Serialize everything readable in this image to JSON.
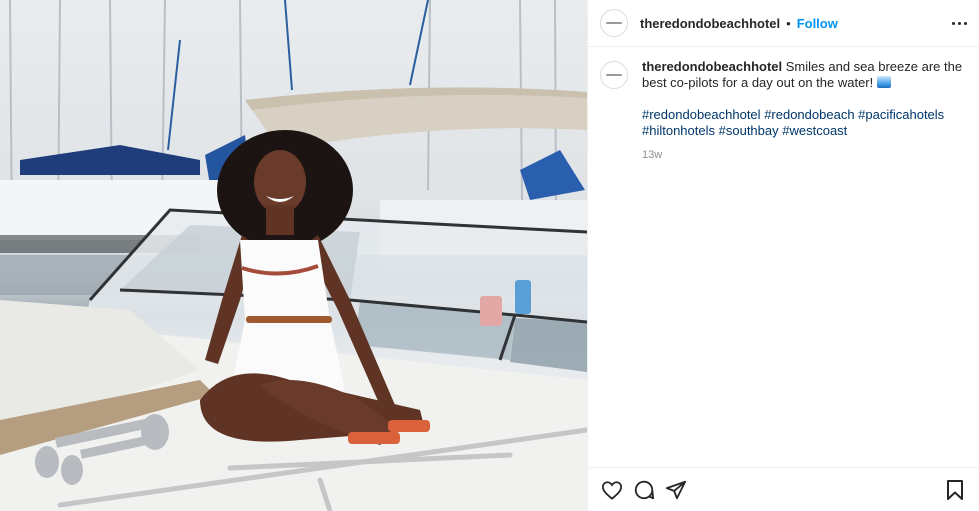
{
  "post": {
    "image_description_alt": "",
    "header": {
      "username": "theredondobeachhotel",
      "separator": "•",
      "follow_label": "Follow",
      "more_icon": "more-options-icon"
    },
    "caption": {
      "username": "theredondobeachhotel",
      "text": "Smiles and sea breeze are the best co-pilots for a day out on the water!",
      "emoji_icon": "water-wave-icon",
      "hashtags": [
        "#redondobeachhotel",
        "#redondobeach",
        "#pacificahotels",
        "#hiltonhotels",
        "#southbay",
        "#westcoast"
      ],
      "time": "13w"
    },
    "actions": {
      "like_icon": "heart-icon",
      "comment_icon": "comment-icon",
      "share_icon": "share-icon",
      "save_icon": "bookmark-icon"
    }
  }
}
